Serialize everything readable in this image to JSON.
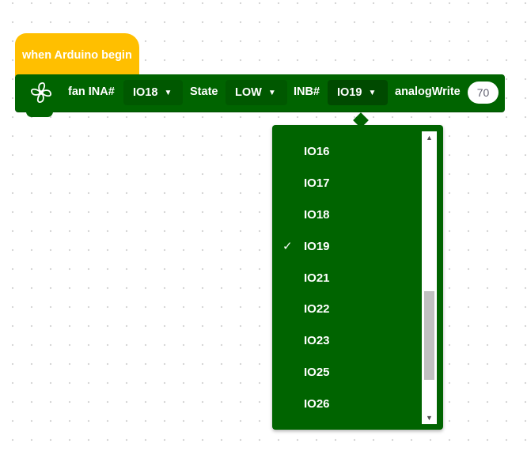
{
  "hat_block": {
    "label": "when Arduino begin"
  },
  "command_block": {
    "icon": "fan-icon",
    "fan_label": "fan INA#",
    "ina_value": "IO18",
    "state_label": "State",
    "state_value": "LOW",
    "inb_label": "INB#",
    "inb_value": "IO19",
    "analog_label": "analogWrite",
    "analog_value": "70"
  },
  "dropdown": {
    "items": [
      "IO16",
      "IO17",
      "IO18",
      "IO19",
      "IO21",
      "IO22",
      "IO23",
      "IO25",
      "IO26"
    ],
    "selected": "IO19",
    "check_mark": "✓",
    "scroll_position": 0.65
  },
  "colors": {
    "hat": "#ffbf00",
    "block": "#006400",
    "field": "#005800"
  }
}
